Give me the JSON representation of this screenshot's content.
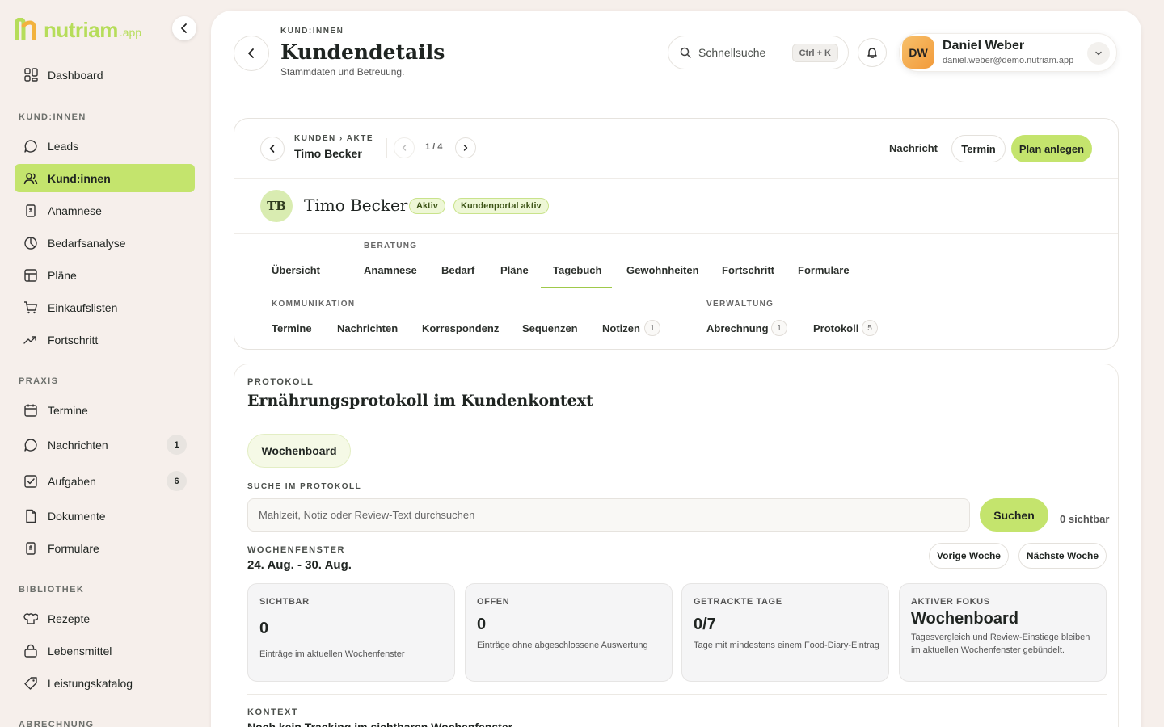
{
  "brand": {
    "name": "nutriam",
    "suffix": ".app"
  },
  "sidebar": {
    "dashboard": "Dashboard",
    "sections": {
      "kunden": "KUND:INNEN",
      "praxis": "PRAXIS",
      "bibliothek": "BIBLIOTHEK",
      "abrechnung": "ABRECHNUNG"
    },
    "items": {
      "leads": "Leads",
      "kunden": "Kund:innen",
      "anamnese": "Anamnese",
      "bedarfsanalyse": "Bedarfsanalyse",
      "plaene": "Pläne",
      "einkaufslisten": "Einkaufslisten",
      "fortschritt": "Fortschritt",
      "termine": "Termine",
      "nachrichten": "Nachrichten",
      "nachrichten_badge": "1",
      "aufgaben": "Aufgaben",
      "aufgaben_badge": "6",
      "dokumente": "Dokumente",
      "formulare": "Formulare",
      "rezepte": "Rezepte",
      "lebensmittel": "Lebensmittel",
      "leistungskatalog": "Leistungskatalog"
    }
  },
  "header": {
    "eyebrow": "KUND:INNEN",
    "title": "Kundendetails",
    "subtitle": "Stammdaten und Betreuung.",
    "search_label": "Schnellsuche",
    "search_shortcut": "Ctrl + K",
    "user_initials": "DW",
    "user_name": "Daniel Weber",
    "user_email": "daniel.weber@demo.nutriam.app"
  },
  "client": {
    "breadcrumb": "KUNDEN › AKTE",
    "name": "Timo Becker",
    "pager": "1 / 4",
    "actions": {
      "message": "Nachricht",
      "appointment": "Termin",
      "create_plan": "Plan anlegen"
    },
    "initials": "TB",
    "tags": {
      "status": "Aktiv",
      "portal": "Kundenportal aktiv"
    },
    "tab_groups": {
      "beratung": "BERATUNG",
      "kommunikation": "KOMMUNIKATION",
      "verwaltung": "VERWALTUNG"
    },
    "tabs": {
      "uebersicht": "Übersicht",
      "anamnese": "Anamnese",
      "bedarf": "Bedarf",
      "plaene": "Pläne",
      "tagebuch": "Tagebuch",
      "gewohnheiten": "Gewohnheiten",
      "fortschritt": "Fortschritt",
      "formulare": "Formulare",
      "termine": "Termine",
      "nachrichten": "Nachrichten",
      "korrespondenz": "Korrespondenz",
      "sequenzen": "Sequenzen",
      "notizen": "Notizen",
      "notizen_badge": "1",
      "abrechnung": "Abrechnung",
      "abrechnung_badge": "1",
      "protokoll": "Protokoll",
      "protokoll_badge": "5"
    }
  },
  "protocol": {
    "eyebrow": "PROTOKOLL",
    "title": "Ernährungsprotokoll im Kundenkontext",
    "view_chip": "Wochenboard",
    "search_label": "SUCHE IM PROTOKOLL",
    "search_placeholder": "Mahlzeit, Notiz oder Review-Text durchsuchen",
    "search_button": "Suchen",
    "visible_count": "0 sichtbar",
    "week_label": "WOCHENFENSTER",
    "week_range": "24. Aug. - 30. Aug.",
    "prev_week": "Vorige Woche",
    "next_week": "Nächste Woche",
    "stats": [
      {
        "label": "SICHTBAR",
        "value": "0",
        "desc": "Einträge im aktuellen Wochenfenster"
      },
      {
        "label": "OFFEN",
        "value": "0",
        "desc": "Einträge ohne abgeschlossene Auswertung"
      },
      {
        "label": "GETRACKTE TAGE",
        "value": "0/7",
        "desc": "Tage mit mindestens einem Food-Diary-Eintrag"
      },
      {
        "label": "AKTIVER FOKUS",
        "value": "Wochenboard",
        "desc": "Tagesvergleich und Review-Einstiege bleiben im aktuellen Wochenfenster gebündelt."
      }
    ],
    "context_label": "KONTEXT",
    "context_title": "Noch kein Tracking im sichtbaren Wochenfenster"
  }
}
